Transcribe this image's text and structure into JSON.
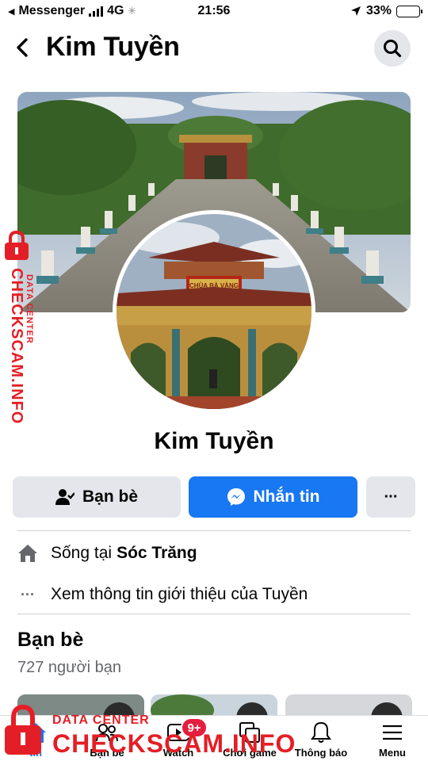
{
  "status_bar": {
    "carrier": "Messenger",
    "network": "4G",
    "time": "21:56",
    "battery": "33%",
    "battery_level": 0.33
  },
  "header": {
    "title": "Kim Tuyền",
    "back_icon": "chevron-left-icon",
    "search_icon": "search-icon"
  },
  "profile": {
    "cover_label": "CHÙA BÀ VÀNG",
    "name": "Kim Tuyền"
  },
  "actions": {
    "friends_label": "Bạn bè",
    "message_label": "Nhắn tin",
    "more_label": "···"
  },
  "intro": {
    "lives_prefix": "Sống tại",
    "lives_place": "Sóc Trăng",
    "see_about": "Xem thông tin giới thiệu của Tuyền"
  },
  "friends": {
    "title": "Bạn bè",
    "count": "727 người bạn"
  },
  "tab_bar": {
    "tabs": [
      {
        "label": "tin",
        "icon": "home-icon"
      },
      {
        "label": "Bạn bè",
        "icon": "friends-icon"
      },
      {
        "label": "Watch",
        "icon": "watch-icon"
      },
      {
        "label": "Chơi game",
        "icon": "gaming-icon"
      },
      {
        "label": "Thông báo",
        "icon": "bell-icon"
      },
      {
        "label": "Menu",
        "icon": "menu-icon"
      }
    ],
    "watch_badge": "9+"
  },
  "watermark": {
    "vertical_text": "CHECKSCAM.INFO",
    "vertical_sub": "DATA CENTER",
    "bottom_sub": "DATA CENTER",
    "bottom_text": "CHECKSCAM.INFO"
  },
  "colors": {
    "accent": "#1877f2",
    "badge": "#e41e3f",
    "watermark": "#e41e26"
  }
}
